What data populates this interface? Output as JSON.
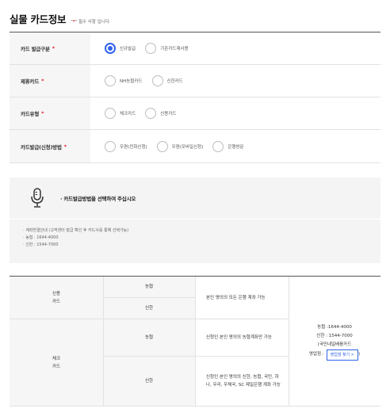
{
  "header": {
    "title": "실물 카드정보",
    "req_star": "*",
    "req_note": "필수 사항 입니다."
  },
  "form": {
    "rows": [
      {
        "label": "카드 발급구분",
        "star": "*",
        "options": [
          {
            "label": "신규발급",
            "selected": true
          },
          {
            "label": "기존카드재사용",
            "selected": false
          }
        ]
      },
      {
        "label": "제휴카드",
        "star": "*",
        "options": [
          {
            "label": "NH농협카드",
            "selected": false
          },
          {
            "label": "신한카드",
            "selected": false
          }
        ]
      },
      {
        "label": "카드유형",
        "star": "*",
        "options": [
          {
            "label": "체크카드",
            "selected": false
          },
          {
            "label": "신용카드",
            "selected": false
          }
        ]
      },
      {
        "label": "카드발급(신청)방법",
        "star": "*",
        "options": [
          {
            "label": "우편(전화신청)",
            "selected": false
          },
          {
            "label": "우편(모바일신청)",
            "selected": false
          },
          {
            "label": "은행방문",
            "selected": false
          }
        ]
      }
    ]
  },
  "info": {
    "icon": "microphone-icon",
    "message": "카드발급방법을 선택하여 주십시오"
  },
  "notes": [
    "계좌연결안내 (고객센터 발급 확인 후 카드사를 통해 선택가능)",
    "농협 : 1644-4000",
    "신한 : 1544-7000"
  ],
  "table": {
    "credit_label": "신용\n카드",
    "check_label": "체크\n카드",
    "nh": "농협",
    "shinhan": "신한",
    "credit_desc": "본인 명의의 모든 은행 계좌 가능",
    "check_nh_desc": "신청인 본인 명의의 농협계좌만 가능",
    "check_shinhan_desc": "신청인 본인 명의의 신한, 농협, 국민, 하나, 우리, 우체국, SC 제일은행 계좌 가능",
    "contact": {
      "nh_phone": "농협 :1644-4000",
      "shinhan_phone": "신한 : 1544-7000",
      "note": "(국민내일배움카드",
      "branch_label": "영업점 :",
      "branch_button": "영업점 찾기 >",
      "close_paren": ")"
    }
  },
  "colors": {
    "accent": "#2f63e9",
    "required": "#e4202a"
  }
}
